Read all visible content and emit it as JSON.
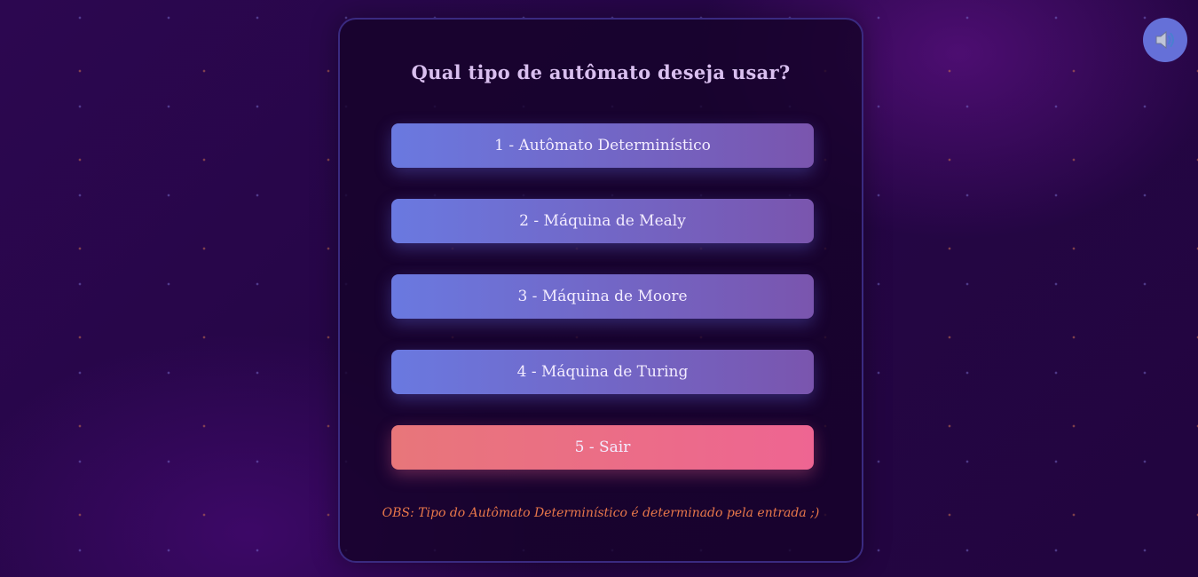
{
  "sound_toggle": {
    "icon": "speaker-icon",
    "color": "#6570d8"
  },
  "menu": {
    "title": "Qual tipo de autômato deseja usar?",
    "options": [
      {
        "label": "1 - Autômato Determinístico"
      },
      {
        "label": "2 - Máquina de Mealy"
      },
      {
        "label": "3 - Máquina de Moore"
      },
      {
        "label": "4 - Máquina de Turing"
      },
      {
        "label": "5 - Sair"
      }
    ],
    "note": "OBS: Tipo do Autômato Determinístico é determinado pela entrada ;)"
  },
  "colors": {
    "option_gradient": [
      "#6a79e0",
      "#7a55ae"
    ],
    "exit_gradient": [
      "#e8767a",
      "#ee6592"
    ],
    "note": "#e8774a",
    "title": "#d9bfef"
  }
}
